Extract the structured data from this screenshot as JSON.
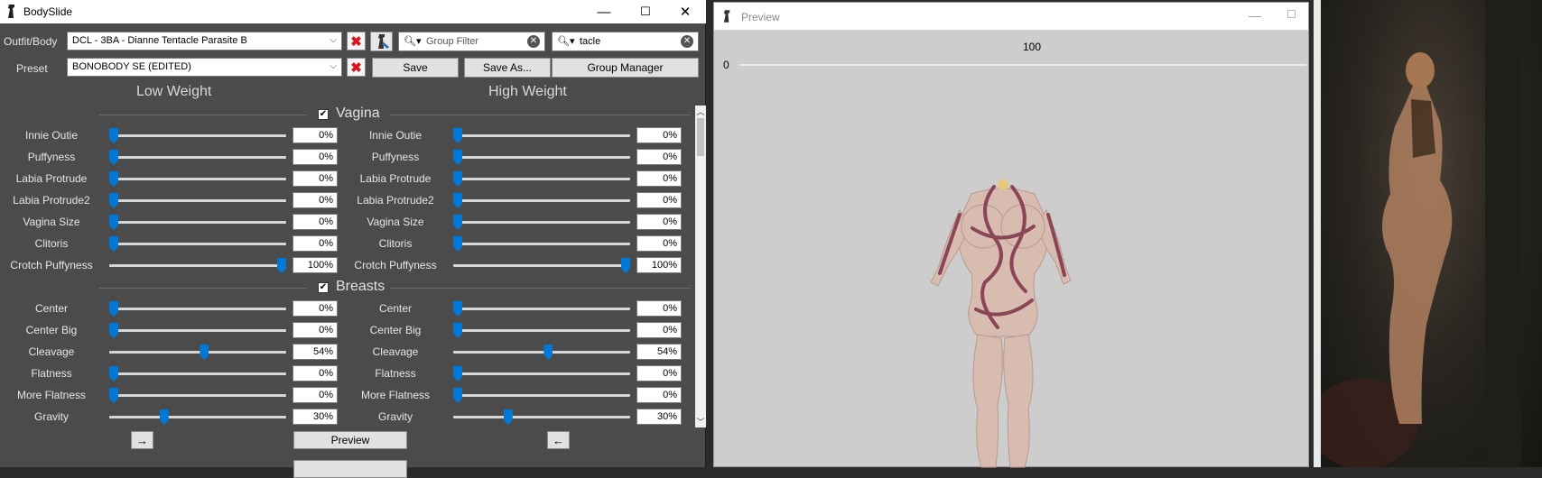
{
  "app_title": "BodySlide",
  "window_controls": {
    "minimize": "—",
    "maximize": "☐",
    "close": "✕"
  },
  "outfit": {
    "label": "Outfit/Body",
    "value": "DCL - 3BA - Dianne Tentacle Parasite B"
  },
  "preset": {
    "label": "Preset",
    "value": "BONOBODY SE (EDITED)"
  },
  "group_filter": {
    "placeholder": "Group Filter"
  },
  "outfit_filter": {
    "value": "tacle"
  },
  "buttons": {
    "save": "Save",
    "save_as": "Save As...",
    "group_manager": "Group Manager",
    "preview": "Preview",
    "left_arrow": "→",
    "right_arrow": "←"
  },
  "columns": {
    "low": "Low Weight",
    "high": "High Weight"
  },
  "groups": [
    {
      "name": "Vagina",
      "checked": true,
      "sliders": [
        {
          "name": "Innie Outie",
          "low": 0,
          "high": 0,
          "low_text": "0%",
          "high_text": "0%"
        },
        {
          "name": "Puffyness",
          "low": 0,
          "high": 0,
          "low_text": "0%",
          "high_text": "0%"
        },
        {
          "name": "Labia Protrude",
          "low": 0,
          "high": 0,
          "low_text": "0%",
          "high_text": "0%"
        },
        {
          "name": "Labia Protrude2",
          "low": 0,
          "high": 0,
          "low_text": "0%",
          "high_text": "0%"
        },
        {
          "name": "Vagina Size",
          "low": 0,
          "high": 0,
          "low_text": "0%",
          "high_text": "0%"
        },
        {
          "name": "Clitoris",
          "low": 0,
          "high": 0,
          "low_text": "0%",
          "high_text": "0%"
        },
        {
          "name": "Crotch Puffyness",
          "low": 100,
          "high": 100,
          "low_text": "100%",
          "high_text": "100%"
        }
      ]
    },
    {
      "name": "Breasts",
      "checked": true,
      "sliders": [
        {
          "name": "Center",
          "low": 0,
          "high": 0,
          "low_text": "0%",
          "high_text": "0%"
        },
        {
          "name": "Center Big",
          "low": 0,
          "high": 0,
          "low_text": "0%",
          "high_text": "0%"
        },
        {
          "name": "Cleavage",
          "low": 54,
          "high": 54,
          "low_text": "54%",
          "high_text": "54%"
        },
        {
          "name": "Flatness",
          "low": 0,
          "high": 0,
          "low_text": "0%",
          "high_text": "0%"
        },
        {
          "name": "More Flatness",
          "low": 0,
          "high": 0,
          "low_text": "0%",
          "high_text": "0%"
        },
        {
          "name": "Gravity",
          "low": 30,
          "high": 30,
          "low_text": "30%",
          "high_text": "30%"
        }
      ]
    }
  ],
  "preview": {
    "title": "Preview",
    "weight_max_label": "100",
    "weight_min_label": "0"
  },
  "colors": {
    "accent": "#0078d7",
    "panel": "#4b4b4b",
    "danger": "#d8141e"
  }
}
